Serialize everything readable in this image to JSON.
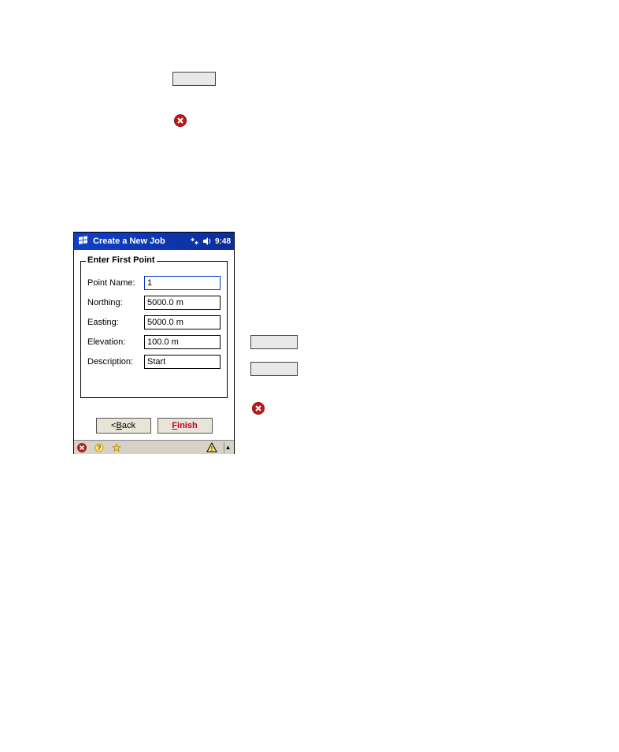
{
  "float_button_top": "",
  "float_button_mid_a": "",
  "float_button_mid_b": "",
  "pda": {
    "title": "Create a New Job",
    "time": "9:48",
    "group_legend": "Enter First Point",
    "fields": {
      "point_name_label": "Point Name:",
      "point_name_value": "1",
      "northing_label": "Northing:",
      "northing_value": "5000.0 m",
      "easting_label": "Easting:",
      "easting_value": "5000.0 m",
      "elevation_label": "Elevation:",
      "elevation_value": "100.0 m",
      "description_label": "Description:",
      "description_value": "Start"
    },
    "buttons": {
      "back_prefix": "< ",
      "back_mn": "B",
      "back_suffix": "ack",
      "finish_mn": "F",
      "finish_suffix": "inish"
    }
  }
}
